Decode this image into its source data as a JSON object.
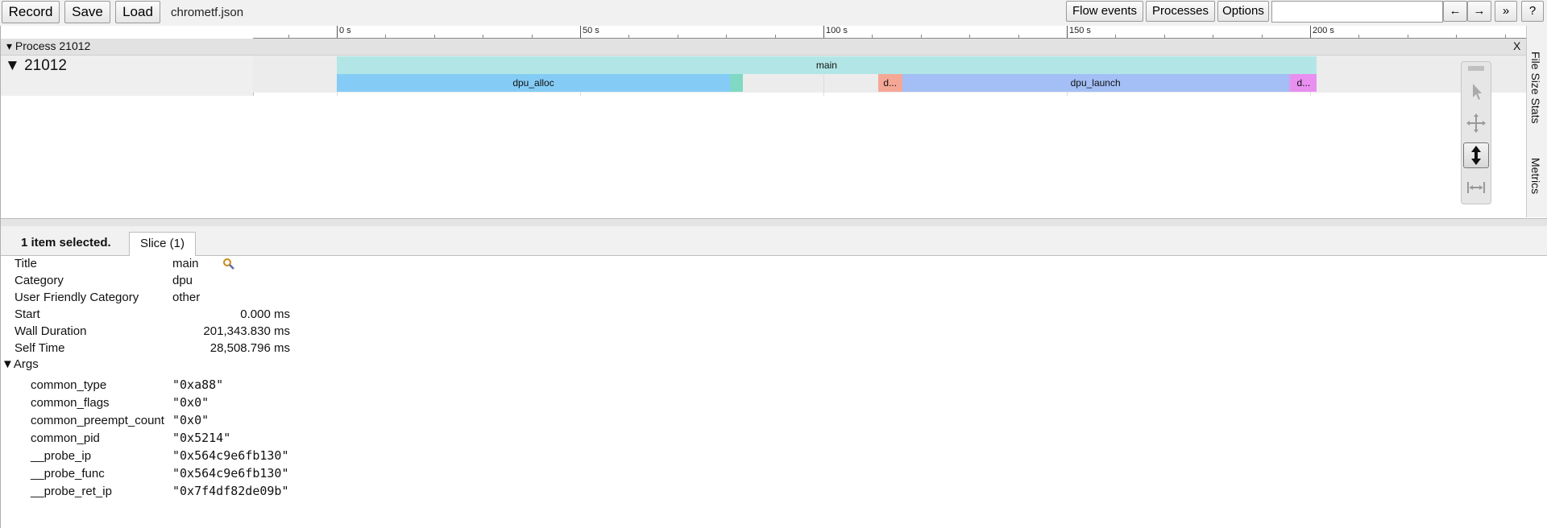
{
  "toolbar": {
    "record_label": "Record",
    "save_label": "Save",
    "load_label": "Load",
    "filename": "chrometf.json",
    "flow_events_label": "Flow events",
    "processes_label": "Processes",
    "options_label": "Options",
    "search_placeholder": "",
    "prev_label": "←",
    "next_label": "→",
    "expand_label": "»",
    "help_label": "?"
  },
  "side_tabs": [
    "File Size Stats",
    "Metrics"
  ],
  "ruler": {
    "labels": [
      "0 s",
      "50 s",
      "100 s",
      "150 s",
      "200 s"
    ]
  },
  "process": {
    "title": "▾ Process 21012",
    "close_label": "X",
    "thread": {
      "title": "▼  21012",
      "slices": [
        {
          "name": "main",
          "depth": 0,
          "start_s": 0,
          "end_s": 201.3,
          "color": "#b2e6e6"
        },
        {
          "name": "dpu_alloc",
          "depth": 1,
          "start_s": 0,
          "end_s": 80.8,
          "color": "#84ccf6"
        },
        {
          "name": "",
          "depth": 1,
          "start_s": 80.8,
          "end_s": 83.5,
          "color": "#7fd9c4"
        },
        {
          "name": "d...",
          "depth": 1,
          "start_s": 111.2,
          "end_s": 116.2,
          "color": "#f5a796"
        },
        {
          "name": "dpu_launch",
          "depth": 1,
          "start_s": 116.2,
          "end_s": 195.6,
          "color": "#a3bff5"
        },
        {
          "name": "",
          "depth": 1,
          "start_s": 195.6,
          "end_s": 196.0,
          "color": "#c8a8f0"
        },
        {
          "name": "d...",
          "depth": 1,
          "start_s": 196.0,
          "end_s": 201.3,
          "color": "#e88ff0"
        }
      ]
    }
  },
  "details": {
    "selection_count": "1 item selected.",
    "tab_label": "Slice (1)",
    "fields": [
      {
        "label": "Title",
        "value": "main"
      },
      {
        "label": "Category",
        "value": "dpu"
      },
      {
        "label": "User Friendly Category",
        "value": "other"
      },
      {
        "label": "Start",
        "value": "0.000 ms"
      },
      {
        "label": "Wall Duration",
        "value": "201,343.830 ms"
      },
      {
        "label": "Self Time",
        "value": "28,508.796 ms"
      }
    ],
    "args_title": "▼Args",
    "args": [
      {
        "label": "common_type",
        "value": "\"0xa88\""
      },
      {
        "label": "common_flags",
        "value": "\"0x0\""
      },
      {
        "label": "common_preempt_count",
        "value": "\"0x0\""
      },
      {
        "label": "common_pid",
        "value": "\"0x5214\""
      },
      {
        "label": "__probe_ip",
        "value": "\"0x564c9e6fb130\""
      },
      {
        "label": "__probe_func",
        "value": "\"0x564c9e6fb130\""
      },
      {
        "label": "__probe_ret_ip",
        "value": "\"0x7f4df82de09b\""
      }
    ]
  }
}
